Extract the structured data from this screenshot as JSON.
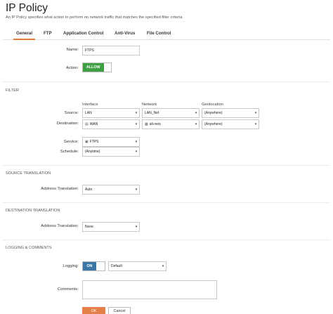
{
  "page": {
    "title": "IP Policy",
    "description": "An IP Policy specifies what action to perform on network traffic that matches the specified filter criteria."
  },
  "tabs": [
    "General",
    "FTP",
    "Application Control",
    "Anti-Virus",
    "File Control"
  ],
  "active_tab": "General",
  "general": {
    "name_label": "Name:",
    "name_value": "FTPS",
    "action_label": "Action:",
    "action_value": "ALLOW",
    "action_color": "#3ea043"
  },
  "filter": {
    "section_title": "FILTER",
    "columns": [
      "Interface",
      "Network",
      "Geolocation"
    ],
    "source_label": "Source:",
    "source": {
      "interface": "LAN",
      "network": "LAN_Net",
      "geolocation": "(Anywhere)"
    },
    "destination_label": "Destination:",
    "destination": {
      "interface": "WAN",
      "network": "all-nets",
      "geolocation": "(Anywhere)"
    },
    "service_label": "Service:",
    "service_value": "FTPS",
    "schedule_label": "Schedule:",
    "schedule_value": "(Anytime)"
  },
  "source_translation": {
    "section_title": "SOURCE TRANSLATION",
    "label": "Address Translation:",
    "value": "Auto"
  },
  "destination_translation": {
    "section_title": "DESTINATION TRANSLATION",
    "label": "Address Translation:",
    "value": "None"
  },
  "logging": {
    "section_title": "LOGGING & COMMENTS",
    "logging_label": "Logging:",
    "logging_toggle": "ON",
    "logging_toggle_color": "#3b76a6",
    "logging_value": "Default",
    "comments_label": "Comments:",
    "comments_value": ""
  },
  "buttons": {
    "ok": "OK",
    "cancel": "Cancel",
    "ok_color": "#e5804a"
  },
  "colors": {
    "accent": "#e07b39"
  }
}
